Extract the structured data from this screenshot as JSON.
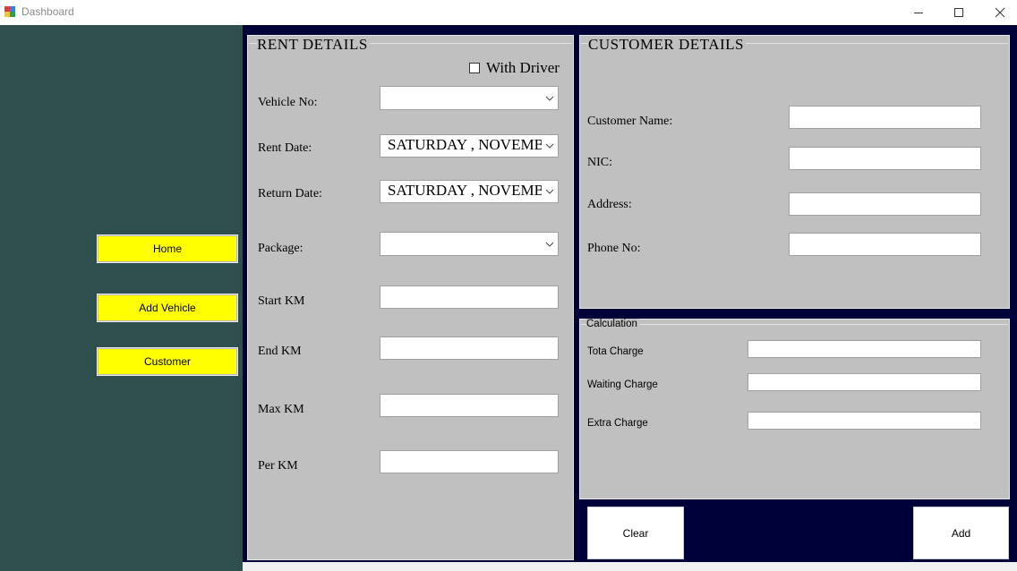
{
  "window": {
    "title": "Dashboard"
  },
  "sidebar": {
    "items": [
      {
        "label": "Home"
      },
      {
        "label": "Add Vehicle"
      },
      {
        "label": "Customer"
      }
    ]
  },
  "rent": {
    "title": "RENT DETAILS",
    "with_driver": "With Driver",
    "vehicle_no": "Vehicle No:",
    "rent_date": "Rent Date:",
    "rent_date_value": "SATURDAY  , NOVEMBER",
    "return_date": "Return Date:",
    "return_date_value": "SATURDAY  , NOVEMBER",
    "package": "Package:",
    "start_km": "Start KM",
    "end_km": "End KM",
    "max_km": "Max KM",
    "per_km": "Per KM"
  },
  "customer": {
    "title": "CUSTOMER DETAILS",
    "name": "Customer Name:",
    "nic": "NIC:",
    "address": "Address:",
    "phone": "Phone No:"
  },
  "calculation": {
    "title": "Calculation",
    "total": "Tota Charge",
    "waiting": "Waiting Charge",
    "extra": "Extra Charge"
  },
  "actions": {
    "clear": "Clear",
    "add": "Add"
  }
}
